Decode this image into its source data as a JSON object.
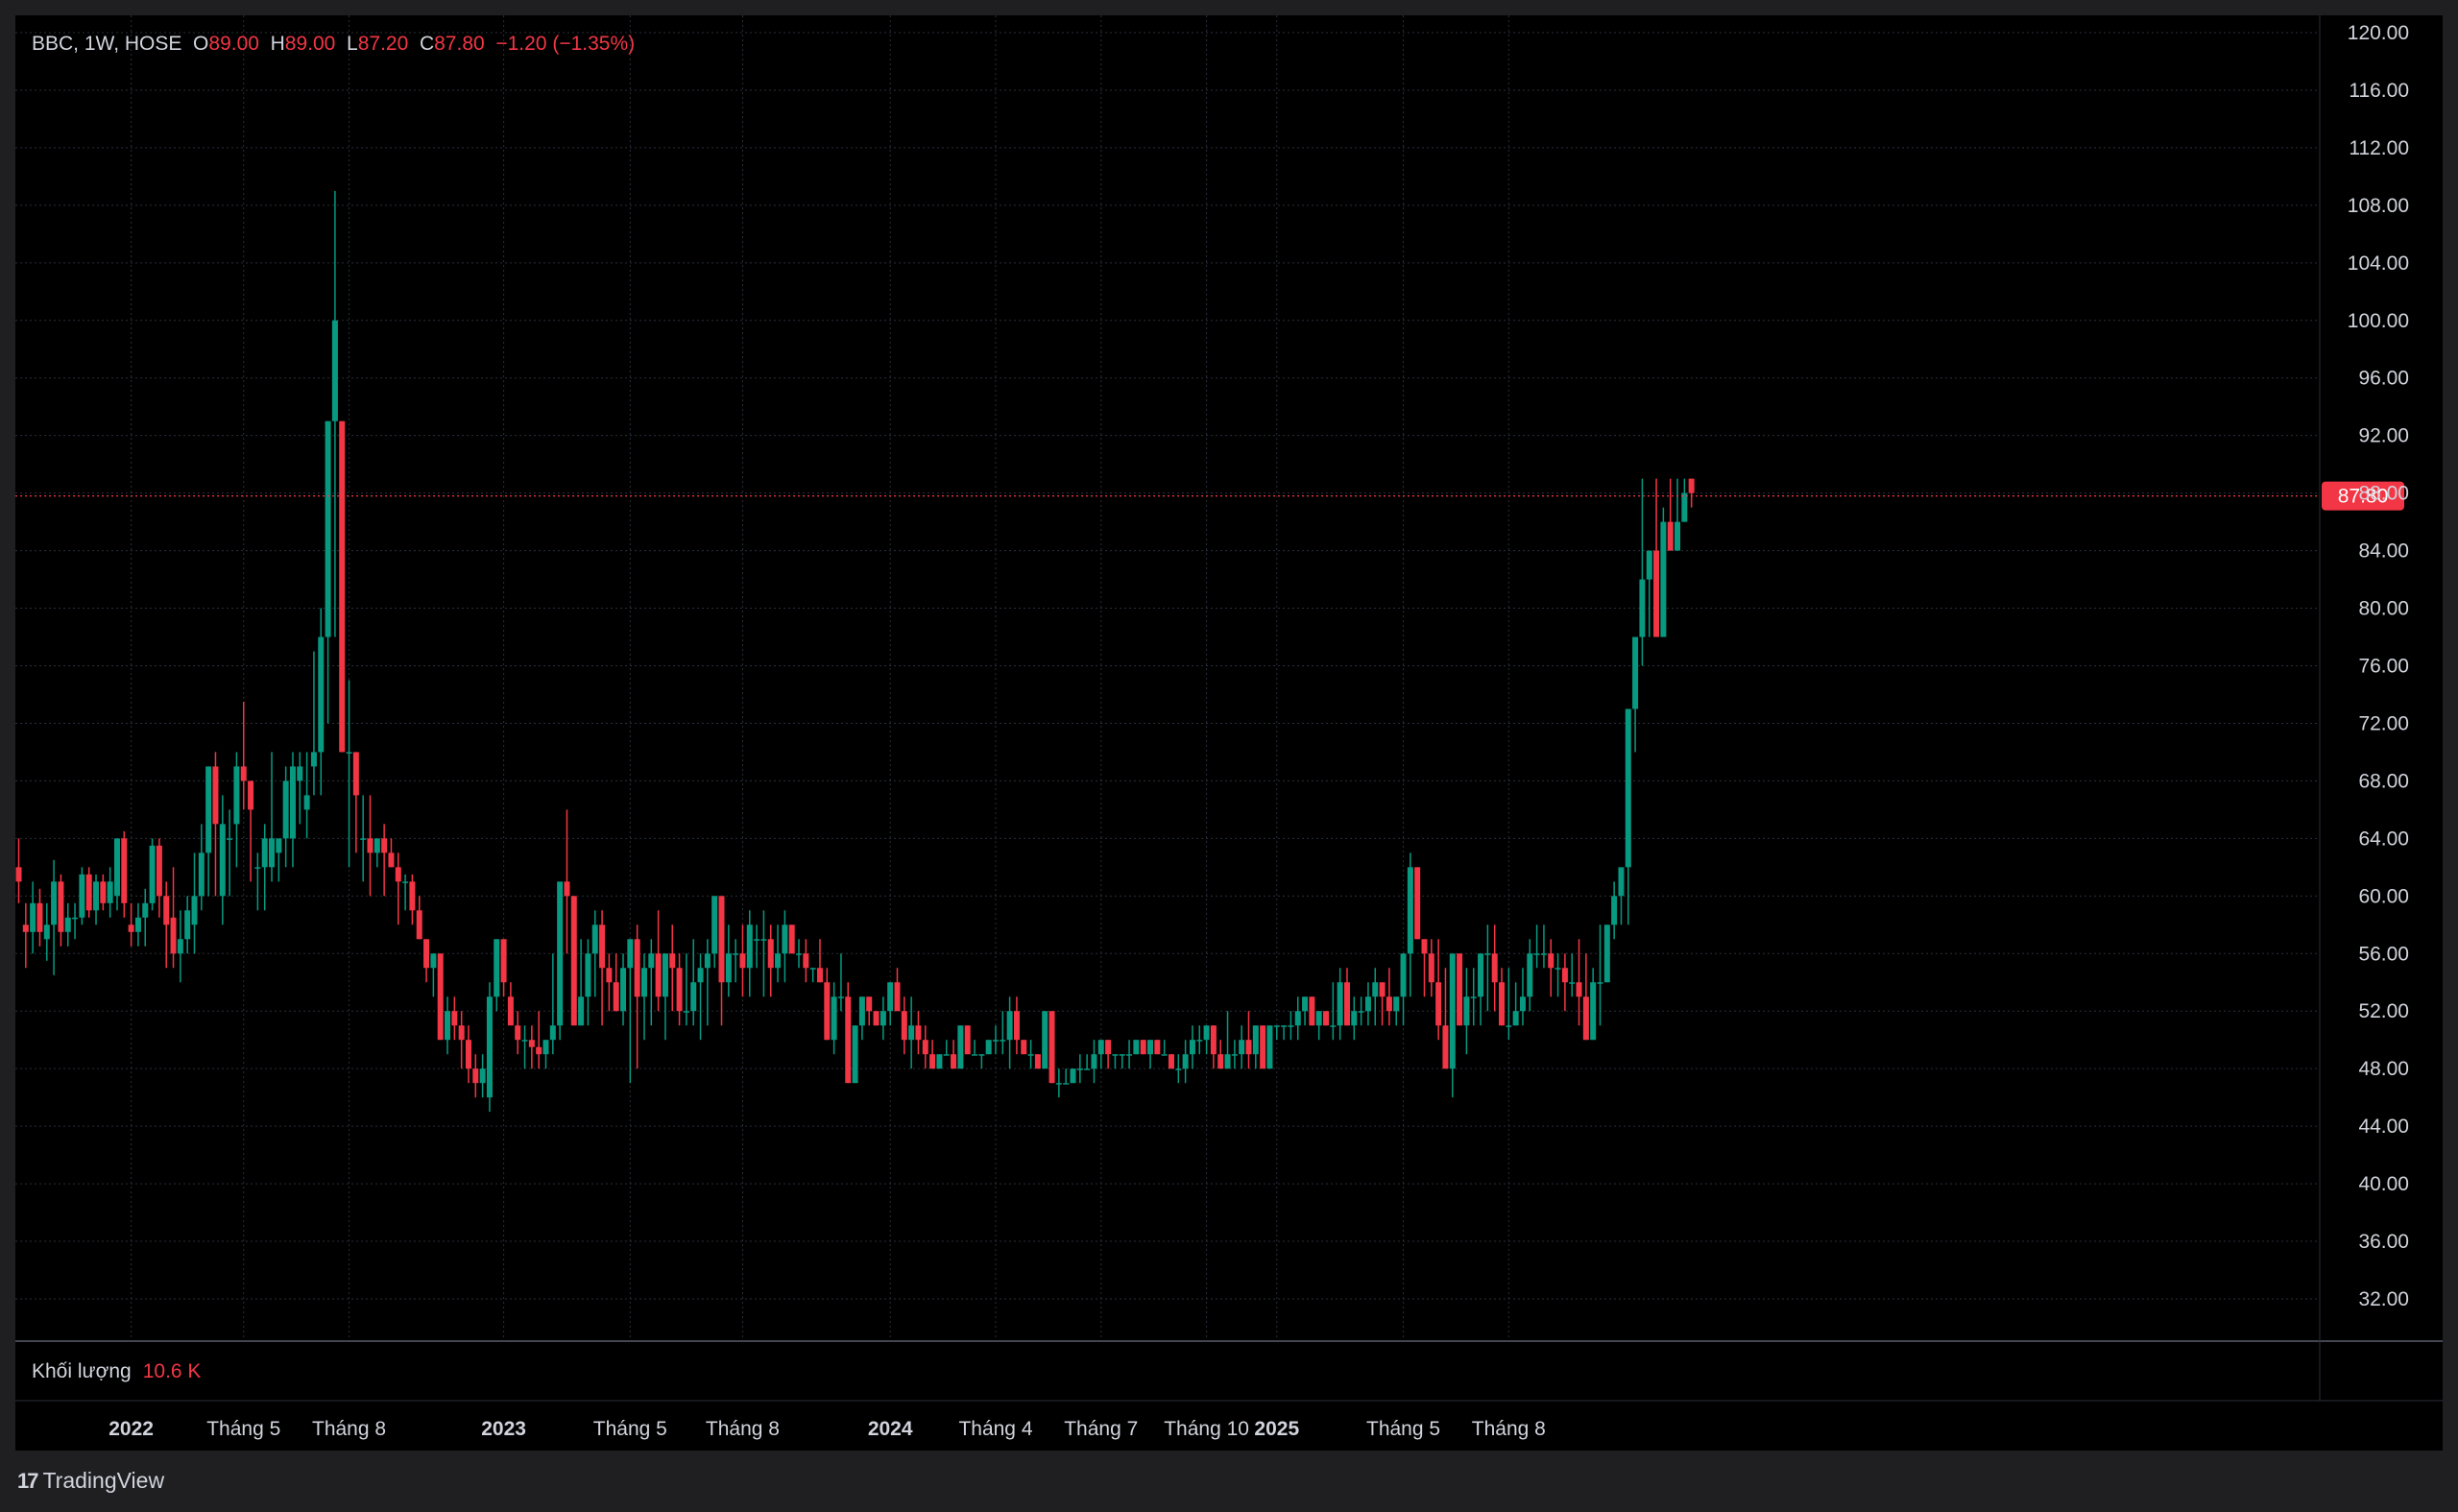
{
  "header": {
    "symbol": "BBC, 1W, HOSE",
    "open_label": "O",
    "open": "89.00",
    "high_label": "H",
    "high": "89.00",
    "low_label": "L",
    "low": "87.20",
    "close_label": "C",
    "close": "87.80",
    "change": "−1.20 (−1.35%)"
  },
  "volume": {
    "label": "Khối lượng",
    "value": "10.6 K"
  },
  "branding": {
    "logo_mark": "17",
    "name": "TradingView"
  },
  "colors": {
    "up": "#089981",
    "down": "#f23645",
    "background": "#000000",
    "grid": "#2a2e39",
    "text": "#d1d4dc",
    "price_line": "#f23645"
  },
  "chart_data": {
    "type": "candlestick",
    "symbol": "BBC",
    "interval": "1W",
    "exchange": "HOSE",
    "ylim": [
      30.0,
      121.0
    ],
    "y_ticks": [
      "120.00",
      "116.00",
      "112.00",
      "108.00",
      "104.00",
      "100.00",
      "96.00",
      "92.00",
      "88.00",
      "84.00",
      "80.00",
      "76.00",
      "72.00",
      "68.00",
      "64.00",
      "60.00",
      "56.00",
      "52.00",
      "48.00",
      "44.00",
      "40.00",
      "36.00",
      "32.00"
    ],
    "current_price": "87.80",
    "x_labels": [
      {
        "text": "2022",
        "bold": true,
        "week": 16
      },
      {
        "text": "Tháng 5",
        "bold": false,
        "week": 32
      },
      {
        "text": "Tháng 8",
        "bold": false,
        "week": 47
      },
      {
        "text": "2023",
        "bold": true,
        "week": 69
      },
      {
        "text": "Tháng 5",
        "bold": false,
        "week": 87
      },
      {
        "text": "Tháng 8",
        "bold": false,
        "week": 103
      },
      {
        "text": "2024",
        "bold": true,
        "week": 124
      },
      {
        "text": "Tháng 4",
        "bold": false,
        "week": 139
      },
      {
        "text": "Tháng 7",
        "bold": false,
        "week": 154
      },
      {
        "text": "Tháng 10",
        "bold": false,
        "week": 169
      },
      {
        "text": "2025",
        "bold": true,
        "week": 179
      },
      {
        "text": "Tháng 5",
        "bold": false,
        "week": 197
      },
      {
        "text": "Tháng 8",
        "bold": false,
        "week": 212
      }
    ],
    "candles": [
      [
        62,
        64,
        59.5,
        61
      ],
      [
        58,
        59.5,
        55,
        57.5
      ],
      [
        57.5,
        61,
        56,
        59.5
      ],
      [
        59.5,
        60.5,
        56.5,
        57.5
      ],
      [
        57,
        59.5,
        55.5,
        58
      ],
      [
        58,
        62.5,
        54.5,
        61
      ],
      [
        61,
        61.5,
        56.5,
        57.5
      ],
      [
        57.5,
        59.5,
        56.5,
        58.5
      ],
      [
        58.5,
        59.5,
        57,
        58.5
      ],
      [
        58.5,
        62,
        58,
        61.5
      ],
      [
        61.5,
        62,
        58.5,
        59
      ],
      [
        59,
        61.5,
        58,
        61
      ],
      [
        61,
        61.5,
        59,
        59.5
      ],
      [
        59.5,
        62,
        58.5,
        61
      ],
      [
        60,
        64,
        59,
        64
      ],
      [
        64,
        64.5,
        58.5,
        59.5
      ],
      [
        58,
        59.5,
        56.5,
        57.5
      ],
      [
        57.5,
        59.5,
        56.5,
        58.5
      ],
      [
        58.5,
        60.5,
        56.5,
        59.5
      ],
      [
        59.5,
        64,
        59,
        63.5
      ],
      [
        63.5,
        64,
        58.5,
        60
      ],
      [
        60,
        61,
        55,
        58
      ],
      [
        58.5,
        62,
        55,
        56
      ],
      [
        56,
        59,
        54,
        57
      ],
      [
        57,
        60,
        56,
        59
      ],
      [
        58,
        63,
        56,
        60
      ],
      [
        60,
        65,
        59,
        63
      ],
      [
        63,
        69,
        60,
        69
      ],
      [
        69,
        70,
        60,
        65
      ],
      [
        60,
        67,
        58,
        65
      ],
      [
        64,
        66,
        60,
        64
      ],
      [
        65,
        70,
        62,
        69
      ],
      [
        69,
        73.5,
        66,
        68
      ],
      [
        68,
        68,
        61,
        66
      ],
      [
        62,
        63,
        59,
        62
      ],
      [
        62,
        65,
        59,
        64
      ],
      [
        62,
        70,
        61,
        64
      ],
      [
        63,
        64,
        61,
        64
      ],
      [
        64,
        69,
        62,
        68
      ],
      [
        64,
        70,
        62,
        69
      ],
      [
        68,
        70,
        65,
        69
      ],
      [
        66,
        70,
        64,
        67
      ],
      [
        69,
        77,
        67,
        70
      ],
      [
        70,
        80,
        67,
        78
      ],
      [
        78,
        93,
        72,
        93
      ],
      [
        93,
        109,
        78,
        100
      ],
      [
        93,
        93,
        70,
        70
      ],
      [
        70,
        75,
        62,
        70
      ],
      [
        70,
        70,
        63,
        67
      ],
      [
        64,
        67,
        61,
        64
      ],
      [
        64,
        67,
        60,
        63
      ],
      [
        63,
        64,
        62,
        64
      ],
      [
        64,
        65,
        60,
        63
      ],
      [
        63,
        64,
        62,
        62
      ],
      [
        62,
        63,
        58,
        61
      ],
      [
        61,
        61.5,
        59,
        61
      ],
      [
        61,
        61.5,
        58,
        59
      ],
      [
        59,
        60,
        57,
        57
      ],
      [
        57,
        57,
        54,
        55
      ],
      [
        55,
        56,
        53,
        56
      ],
      [
        56,
        56,
        50,
        50
      ],
      [
        50,
        53,
        49,
        52
      ],
      [
        52,
        53,
        50,
        51
      ],
      [
        51,
        52,
        48,
        50
      ],
      [
        50,
        51,
        47,
        48
      ],
      [
        48,
        49,
        46,
        47
      ],
      [
        47,
        49,
        46,
        48
      ],
      [
        46,
        54,
        45,
        53
      ],
      [
        53,
        57,
        52,
        57
      ],
      [
        57,
        57,
        53,
        54
      ],
      [
        53,
        54,
        52,
        51
      ],
      [
        51,
        52,
        49,
        50
      ],
      [
        50,
        51,
        48,
        50
      ],
      [
        50,
        51,
        48,
        49.5
      ],
      [
        49.5,
        52,
        48,
        49
      ],
      [
        49,
        50,
        48,
        50
      ],
      [
        50,
        56,
        49,
        51
      ],
      [
        51,
        58,
        50,
        61
      ],
      [
        61,
        66,
        56,
        60
      ],
      [
        60,
        60,
        51,
        51
      ],
      [
        51,
        57,
        51,
        53
      ],
      [
        53,
        57,
        51,
        56
      ],
      [
        56,
        59,
        53,
        58
      ],
      [
        58,
        59,
        51,
        55
      ],
      [
        55,
        56,
        52,
        54
      ],
      [
        54,
        56,
        52,
        52
      ],
      [
        52,
        56,
        51,
        55
      ],
      [
        55,
        57,
        47,
        57
      ],
      [
        57,
        58,
        48,
        53
      ],
      [
        53,
        56,
        50,
        55
      ],
      [
        55,
        57,
        51,
        56
      ],
      [
        56,
        59,
        52,
        53
      ],
      [
        53,
        56,
        50,
        56
      ],
      [
        56,
        58,
        52,
        55
      ],
      [
        55,
        56,
        51,
        52
      ],
      [
        52,
        56,
        51,
        52
      ],
      [
        52,
        57,
        51,
        54
      ],
      [
        54,
        56,
        50,
        55
      ],
      [
        55,
        57,
        51,
        56
      ],
      [
        56,
        60,
        55,
        60
      ],
      [
        60,
        60,
        51,
        54
      ],
      [
        54,
        58,
        53,
        56
      ],
      [
        56,
        57,
        54,
        56
      ],
      [
        56,
        58,
        53,
        55
      ],
      [
        55,
        59,
        53,
        58
      ],
      [
        57,
        58,
        55,
        57
      ],
      [
        57,
        59,
        53,
        57
      ],
      [
        57,
        58,
        53,
        55
      ],
      [
        55,
        58,
        54,
        56
      ],
      [
        56,
        59,
        54,
        58
      ],
      [
        58,
        58,
        56,
        56
      ],
      [
        56,
        57,
        55,
        56
      ],
      [
        56,
        57,
        54,
        55
      ],
      [
        55,
        55,
        54,
        55
      ],
      [
        55,
        57,
        54,
        54
      ],
      [
        54,
        55,
        50,
        50
      ],
      [
        50,
        54,
        49,
        53
      ],
      [
        53,
        56,
        52,
        53
      ],
      [
        53,
        54,
        47,
        47
      ],
      [
        47,
        51,
        47,
        51
      ],
      [
        51,
        53,
        50,
        53
      ],
      [
        53,
        53,
        51,
        52
      ],
      [
        52,
        52,
        51,
        51
      ],
      [
        51,
        53,
        50,
        52
      ],
      [
        52,
        54,
        51,
        54
      ],
      [
        54,
        55,
        52,
        52
      ],
      [
        52,
        53,
        49,
        50
      ],
      [
        50,
        53,
        48,
        51
      ],
      [
        51,
        52,
        49,
        50
      ],
      [
        50,
        51,
        48,
        49
      ],
      [
        49,
        50,
        48,
        48
      ],
      [
        48,
        49,
        48,
        49
      ],
      [
        49,
        50,
        49,
        49
      ],
      [
        49,
        50,
        48,
        48
      ],
      [
        48,
        51,
        48,
        51
      ],
      [
        51,
        51,
        49,
        49
      ],
      [
        49,
        50,
        49,
        49
      ],
      [
        49,
        49,
        48,
        49
      ],
      [
        49,
        50,
        49,
        50
      ],
      [
        50,
        51,
        49,
        50
      ],
      [
        50,
        52,
        49,
        50
      ],
      [
        50,
        53,
        48,
        52
      ],
      [
        52,
        53,
        49,
        50
      ],
      [
        50,
        50,
        49,
        49
      ],
      [
        49,
        50,
        48,
        49
      ],
      [
        49,
        49,
        48,
        48
      ],
      [
        48,
        52,
        48,
        52
      ],
      [
        52,
        52,
        47,
        47
      ],
      [
        47,
        48,
        46,
        47
      ],
      [
        47,
        48,
        47,
        47
      ],
      [
        47,
        48,
        47,
        48
      ],
      [
        48,
        49,
        47,
        48
      ],
      [
        48,
        49,
        48,
        48
      ],
      [
        48,
        50,
        47,
        49
      ],
      [
        49,
        50,
        48,
        50
      ],
      [
        50,
        50,
        48,
        49
      ],
      [
        49,
        49,
        48,
        49
      ],
      [
        49,
        49,
        48,
        49
      ],
      [
        49,
        50,
        48,
        49
      ],
      [
        49,
        50,
        49,
        50
      ],
      [
        50,
        50,
        49,
        49
      ],
      [
        49,
        50,
        48,
        50
      ],
      [
        50,
        50,
        49,
        49
      ],
      [
        49,
        50,
        49,
        49
      ],
      [
        49,
        49,
        48,
        48
      ],
      [
        48,
        49,
        47,
        48
      ],
      [
        48,
        50,
        47,
        49
      ],
      [
        49,
        51,
        48,
        50
      ],
      [
        50,
        51,
        49,
        50
      ],
      [
        50,
        51,
        49,
        51
      ],
      [
        51,
        51,
        48,
        49
      ],
      [
        49,
        50,
        48,
        48
      ],
      [
        48,
        52,
        48,
        49
      ],
      [
        49,
        50,
        48,
        49
      ],
      [
        49,
        51,
        48,
        50
      ],
      [
        50,
        52,
        48,
        49
      ],
      [
        49,
        51,
        48,
        51
      ],
      [
        51,
        51,
        48,
        48
      ],
      [
        48,
        51,
        48,
        51
      ],
      [
        51,
        51,
        50,
        51
      ],
      [
        51,
        51,
        50,
        51
      ],
      [
        51,
        52,
        50,
        51
      ],
      [
        51,
        53,
        50,
        52
      ],
      [
        52,
        53,
        51,
        53
      ],
      [
        53,
        53,
        51,
        51
      ],
      [
        51,
        52,
        50,
        52
      ],
      [
        52,
        52,
        51,
        51
      ],
      [
        51,
        54,
        50,
        51
      ],
      [
        51,
        55,
        50,
        54
      ],
      [
        54,
        55,
        51,
        51
      ],
      [
        51,
        53,
        50,
        52
      ],
      [
        52,
        53,
        51,
        52
      ],
      [
        52,
        54,
        51,
        53
      ],
      [
        53,
        55,
        51,
        54
      ],
      [
        54,
        54,
        51,
        53
      ],
      [
        53,
        55,
        51,
        52
      ],
      [
        52,
        53,
        51,
        53
      ],
      [
        53,
        56,
        51,
        56
      ],
      [
        56,
        63,
        53,
        62
      ],
      [
        62,
        62,
        57,
        57
      ],
      [
        57,
        57,
        53,
        56
      ],
      [
        56,
        57,
        53,
        54
      ],
      [
        54,
        57,
        50,
        51
      ],
      [
        51,
        55,
        48,
        48
      ],
      [
        48,
        55,
        46,
        56
      ],
      [
        56,
        56,
        51,
        51
      ],
      [
        51,
        55,
        49,
        53
      ],
      [
        53,
        55,
        51,
        53
      ],
      [
        53,
        56,
        51,
        56
      ],
      [
        56,
        58,
        52,
        56
      ],
      [
        56,
        58,
        52,
        54
      ],
      [
        54,
        55,
        51,
        51
      ],
      [
        51,
        55,
        50,
        51
      ],
      [
        51,
        54,
        51,
        52
      ],
      [
        52,
        55,
        51,
        53
      ],
      [
        53,
        57,
        52,
        56
      ],
      [
        56,
        58,
        55,
        56
      ],
      [
        56,
        58,
        55,
        56
      ],
      [
        56,
        57,
        53,
        55
      ],
      [
        55,
        56,
        53,
        55
      ],
      [
        55,
        56,
        52,
        54
      ],
      [
        54,
        56,
        53,
        54
      ],
      [
        54,
        57,
        51,
        53
      ],
      [
        53,
        56,
        50,
        50
      ],
      [
        50,
        55,
        50,
        54
      ],
      [
        54,
        58,
        51,
        54
      ],
      [
        54,
        58,
        54,
        58
      ],
      [
        58,
        61,
        57,
        60
      ],
      [
        60,
        60,
        58,
        62
      ],
      [
        62,
        70,
        58,
        73
      ],
      [
        73,
        78,
        70,
        78
      ],
      [
        78,
        89,
        76,
        82
      ],
      [
        82,
        84,
        78,
        84
      ],
      [
        84,
        89,
        78,
        78
      ],
      [
        78,
        87,
        78,
        86
      ],
      [
        86,
        89,
        84,
        84
      ],
      [
        84,
        89,
        84,
        86
      ],
      [
        86,
        89,
        86,
        88
      ],
      [
        89,
        89,
        87,
        88
      ]
    ]
  }
}
